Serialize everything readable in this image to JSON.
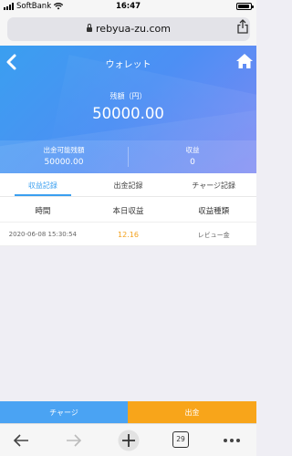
{
  "status_bar": {
    "carrier": "SoftBank",
    "time": "16:47",
    "battery_level": 0.9
  },
  "browser": {
    "url": "rebyua-zu.com",
    "tab_count": "29"
  },
  "header": {
    "title": "ウォレット",
    "balance_label": "残額（円）",
    "balance_value": "50000.00",
    "withdrawable_label": "出金可能残額",
    "withdrawable_value": "50000.00",
    "income_label": "収益",
    "income_value": "0"
  },
  "tabs": [
    {
      "label": "収益記録",
      "active": true
    },
    {
      "label": "出金記録",
      "active": false
    },
    {
      "label": "チャージ記録",
      "active": false
    }
  ],
  "table": {
    "columns": [
      "時間",
      "本日収益",
      "収益種類"
    ],
    "rows": [
      {
        "time": "2020-06-08 15:30:54",
        "amount": "12.16",
        "type": "レビュー金"
      }
    ]
  },
  "actions": {
    "charge_label": "チャージ",
    "withdraw_label": "出金"
  },
  "colors": {
    "accent": "#3a9ff0",
    "amount": "#f3a11c",
    "charge_button": "#4aa3f3",
    "withdraw_button": "#f8a51a"
  },
  "icons": [
    "back-icon",
    "home-icon",
    "lock-icon",
    "share-icon",
    "browser-back-icon",
    "browser-forward-icon",
    "new-tab-icon",
    "tabs-icon",
    "more-icon"
  ]
}
